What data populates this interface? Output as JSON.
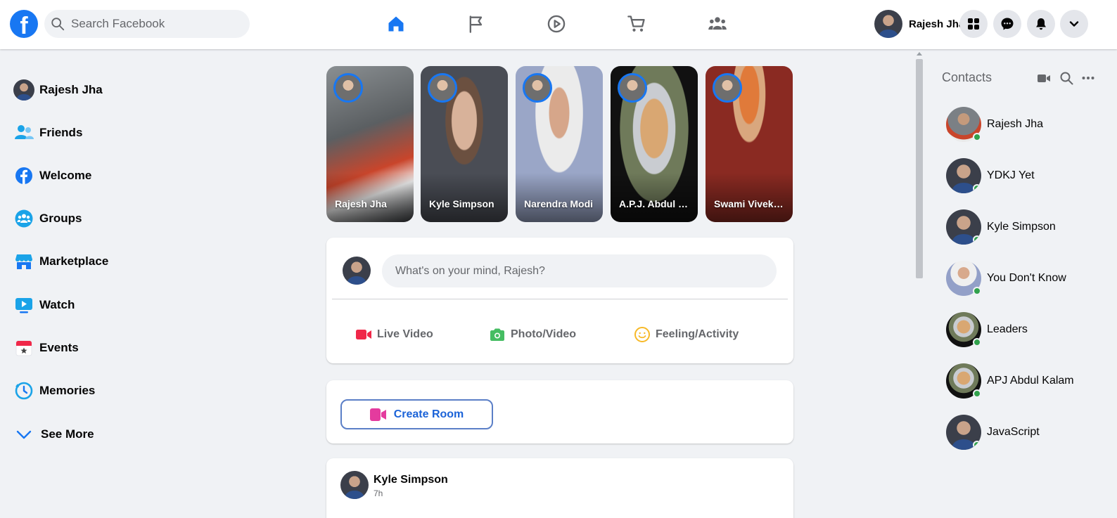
{
  "header": {
    "logo_letter": "f",
    "search_placeholder": "Search Facebook",
    "nav": [
      "home-icon",
      "pages-flag-icon",
      "watch-icon",
      "marketplace-cart-icon",
      "groups-icon"
    ],
    "user_name": "Rajesh Jha",
    "actions": [
      "menu-grid-icon",
      "messenger-icon",
      "notifications-bell-icon",
      "account-dropdown-icon"
    ],
    "active_color": "#1877f2"
  },
  "sidebar": {
    "items": [
      {
        "label": "Rajesh Jha",
        "icon": "avatar"
      },
      {
        "label": "Friends",
        "icon": "friends-icon"
      },
      {
        "label": "Welcome",
        "icon": "facebook-welcome-icon"
      },
      {
        "label": "Groups",
        "icon": "groups-icon"
      },
      {
        "label": "Marketplace",
        "icon": "marketplace-icon"
      },
      {
        "label": "Watch",
        "icon": "watch-icon"
      },
      {
        "label": "Events",
        "icon": "events-calendar-icon"
      },
      {
        "label": "Memories",
        "icon": "memories-clock-icon"
      },
      {
        "label": "See More",
        "icon": "chevron-down-icon"
      }
    ]
  },
  "stories": [
    {
      "name": "Rajesh Jha"
    },
    {
      "name": "Kyle Simpson"
    },
    {
      "name": "Narendra Modi"
    },
    {
      "name": "A.P.J. Abdul Kalam"
    },
    {
      "name": "Swami Vivekananda"
    }
  ],
  "composer": {
    "placeholder": "What's on your mind, Rajesh?",
    "live_video": "Live Video",
    "photo_video": "Photo/Video",
    "feeling": "Feeling/Activity"
  },
  "room": {
    "label": "Create Room"
  },
  "post": {
    "author": "Kyle Simpson",
    "time": "7h"
  },
  "contacts": {
    "title": "Contacts",
    "tools": [
      "video-room-icon",
      "search-icon",
      "more-options-icon"
    ],
    "list": [
      {
        "name": "Rajesh Jha"
      },
      {
        "name": "YDKJ Yet"
      },
      {
        "name": "Kyle Simpson"
      },
      {
        "name": "You Don't Know"
      },
      {
        "name": "Leaders"
      },
      {
        "name": "APJ Abdul Kalam"
      },
      {
        "name": "JavaScript"
      }
    ],
    "online_color": "#31a24c"
  }
}
